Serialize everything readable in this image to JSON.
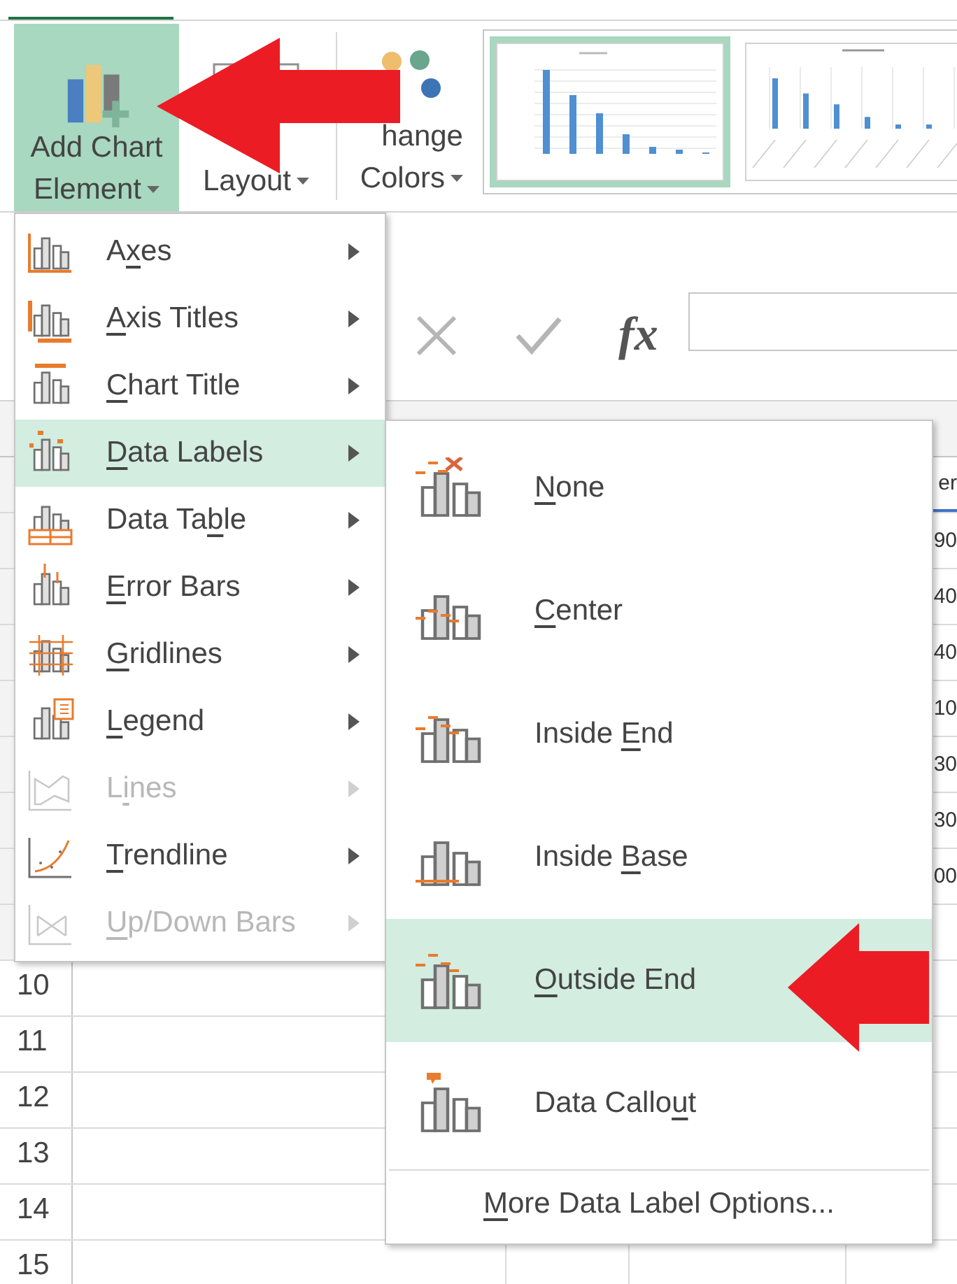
{
  "ribbon": {
    "buttons": [
      {
        "kind": "add_chart",
        "lines": [
          "Add Chart",
          "Element"
        ],
        "selected": true
      },
      {
        "kind": "quick_layout",
        "lines": [
          "Layout"
        ],
        "selected": false
      },
      {
        "kind": "change_colors",
        "lines": [
          "hange",
          "Colors"
        ],
        "selected": false
      }
    ],
    "styles": [
      {
        "kind": "column",
        "selected": true
      },
      {
        "kind": "labeled",
        "selected": false
      }
    ]
  },
  "formula_bar": {
    "function_label": "fx"
  },
  "sheet": {
    "column_d_cells": [
      "er",
      "90",
      "40",
      "40",
      "10",
      "30",
      "30",
      "00"
    ],
    "row_numbers": [
      "10",
      "11",
      "12",
      "13",
      "14",
      "15"
    ]
  },
  "menu": {
    "items": [
      {
        "kind": "axes",
        "label_parts": [
          {
            "text": "A",
            "underlined": false
          },
          {
            "text": "x",
            "underlined": true
          },
          {
            "text": "es",
            "underlined": false
          }
        ],
        "selected": false,
        "disabled": false
      },
      {
        "kind": "axis_titles",
        "label_parts": [
          {
            "text": "A",
            "underlined": true
          },
          {
            "text": "xis Titles",
            "underlined": false
          }
        ],
        "selected": false,
        "disabled": false
      },
      {
        "kind": "chart_title",
        "label_parts": [
          {
            "text": "C",
            "underlined": true
          },
          {
            "text": "hart Title",
            "underlined": false
          }
        ],
        "selected": false,
        "disabled": false
      },
      {
        "kind": "data_labels",
        "label_parts": [
          {
            "text": "D",
            "underlined": true
          },
          {
            "text": "ata Labels",
            "underlined": false
          }
        ],
        "selected": true,
        "disabled": false
      },
      {
        "kind": "data_table",
        "label_parts": [
          {
            "text": "Data Ta",
            "underlined": false
          },
          {
            "text": "b",
            "underlined": true
          },
          {
            "text": "le",
            "underlined": false
          }
        ],
        "selected": false,
        "disabled": false
      },
      {
        "kind": "error_bars",
        "label_parts": [
          {
            "text": "E",
            "underlined": true
          },
          {
            "text": "rror Bars",
            "underlined": false
          }
        ],
        "selected": false,
        "disabled": false
      },
      {
        "kind": "gridlines",
        "label_parts": [
          {
            "text": "G",
            "underlined": true
          },
          {
            "text": "ridlines",
            "underlined": false
          }
        ],
        "selected": false,
        "disabled": false
      },
      {
        "kind": "legend",
        "label_parts": [
          {
            "text": "L",
            "underlined": true
          },
          {
            "text": "egend",
            "underlined": false
          }
        ],
        "selected": false,
        "disabled": false
      },
      {
        "kind": "lines",
        "label_parts": [
          {
            "text": "L",
            "underlined": false
          },
          {
            "text": "i",
            "underlined": true
          },
          {
            "text": "nes",
            "underlined": false
          }
        ],
        "selected": false,
        "disabled": true
      },
      {
        "kind": "trendline",
        "label_parts": [
          {
            "text": "T",
            "underlined": true
          },
          {
            "text": "rendline",
            "underlined": false
          }
        ],
        "selected": false,
        "disabled": false
      },
      {
        "kind": "updown",
        "label_parts": [
          {
            "text": "U",
            "underlined": true
          },
          {
            "text": "p/Down Bars",
            "underlined": false
          }
        ],
        "selected": false,
        "disabled": true
      }
    ]
  },
  "submenu": {
    "items": [
      {
        "kind": "none",
        "label_parts": [
          {
            "text": "N",
            "underlined": true
          },
          {
            "text": "one",
            "underlined": false
          }
        ],
        "selected": false
      },
      {
        "kind": "center",
        "label_parts": [
          {
            "text": "C",
            "underlined": true
          },
          {
            "text": "enter",
            "underlined": false
          }
        ],
        "selected": false
      },
      {
        "kind": "inside_end",
        "label_parts": [
          {
            "text": "Inside ",
            "underlined": false
          },
          {
            "text": "E",
            "underlined": true
          },
          {
            "text": "nd",
            "underlined": false
          }
        ],
        "selected": false
      },
      {
        "kind": "inside_base",
        "label_parts": [
          {
            "text": "Inside ",
            "underlined": false
          },
          {
            "text": "B",
            "underlined": true
          },
          {
            "text": "ase",
            "underlined": false
          }
        ],
        "selected": false
      },
      {
        "kind": "outside_end",
        "label_parts": [
          {
            "text": "O",
            "underlined": true
          },
          {
            "text": "utside End",
            "underlined": false
          }
        ],
        "selected": true
      },
      {
        "kind": "callout",
        "label_parts": [
          {
            "text": "Data Callo",
            "underlined": false
          },
          {
            "text": "u",
            "underlined": true
          },
          {
            "text": "t",
            "underlined": false
          }
        ],
        "selected": false
      }
    ],
    "footer_parts": [
      {
        "text": "M",
        "underlined": true
      },
      {
        "text": "ore Data Label Options...",
        "underlined": false
      }
    ]
  }
}
